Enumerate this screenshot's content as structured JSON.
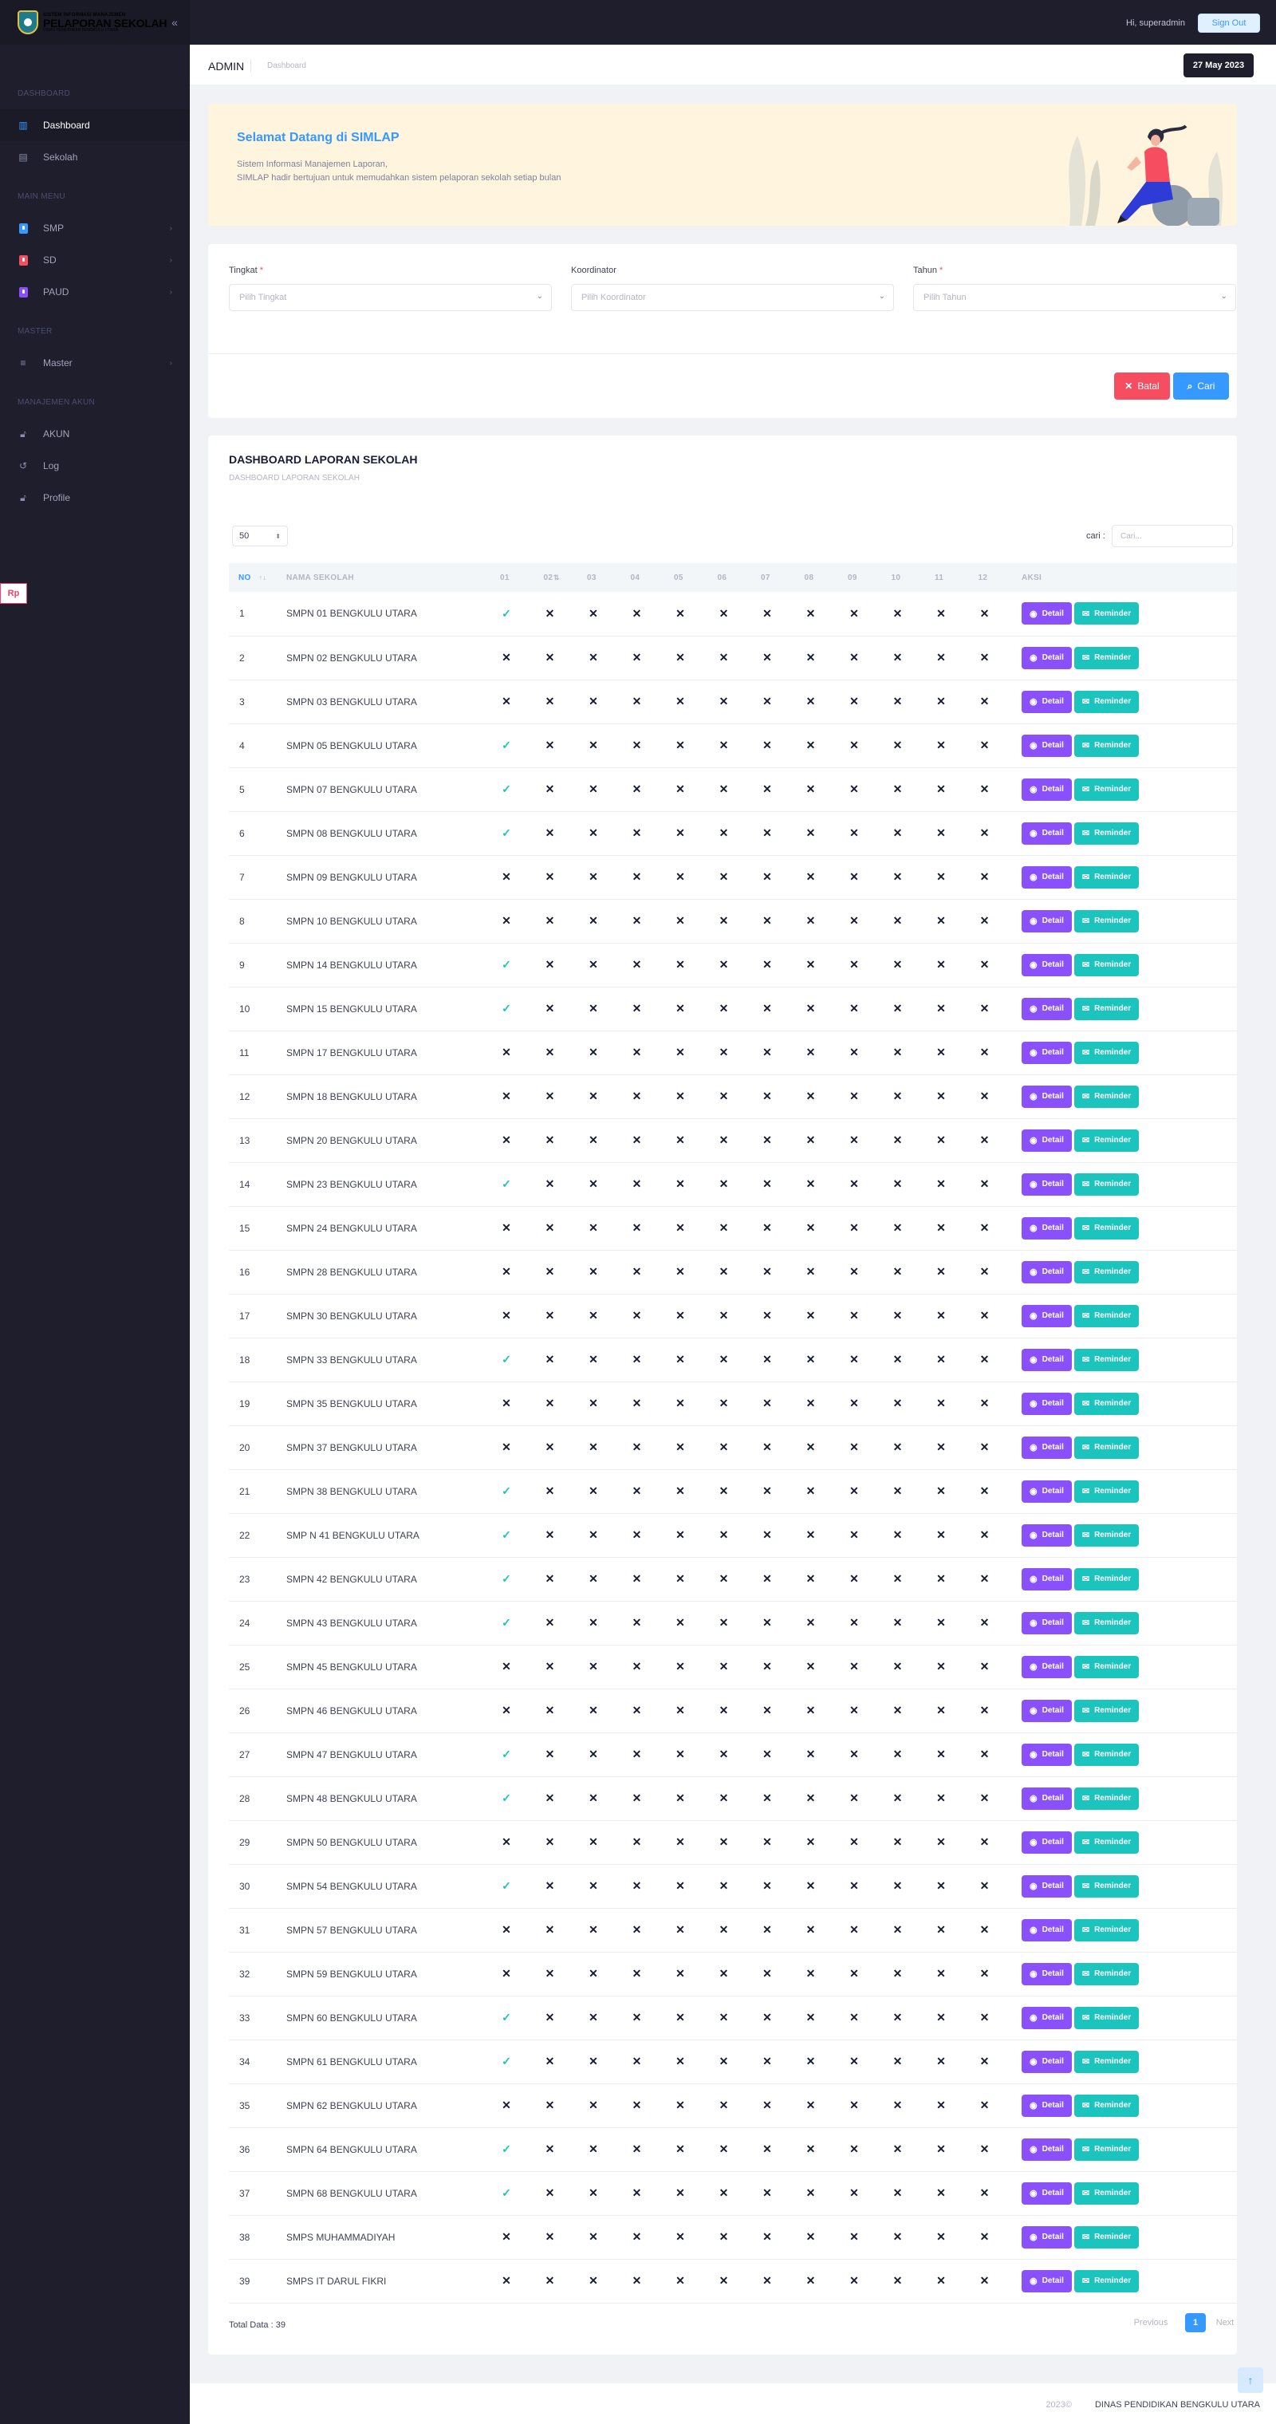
{
  "brand": {
    "line1": "SISTEM INFORMASI MANAJEMEN",
    "line2": "PELAPORAN SEKOLAH",
    "line3": "DINAS PENDIDIKAN BENGKULU UTARA"
  },
  "sidebar": {
    "sections": [
      {
        "label": "DASHBOARD",
        "items": [
          {
            "label": "Dashboard",
            "icon": "chart-icon",
            "active": true
          },
          {
            "label": "Sekolah",
            "icon": "building-icon"
          }
        ]
      },
      {
        "label": "MAIN MENU",
        "items": [
          {
            "label": "SMP",
            "icon": "smp-icon",
            "color": "#3699ff",
            "has_children": true
          },
          {
            "label": "SD",
            "icon": "sd-icon",
            "color": "#f64e60",
            "has_children": true
          },
          {
            "label": "PAUD",
            "icon": "paud-icon",
            "color": "#8950fc",
            "has_children": true
          }
        ]
      },
      {
        "label": "MASTER",
        "items": [
          {
            "label": "Master",
            "icon": "database-icon",
            "has_children": true
          }
        ]
      },
      {
        "label": "MANAJEMEN AKUN",
        "items": [
          {
            "label": "AKUN",
            "icon": "lock-icon"
          },
          {
            "label": "Log",
            "icon": "history-icon"
          },
          {
            "label": "Profile",
            "icon": "lock-icon"
          }
        ]
      }
    ]
  },
  "topbar": {
    "greeting": "Hi, superadmin",
    "signout_label": "Sign Out"
  },
  "subheader": {
    "title": "ADMIN",
    "crumb": "Dashboard",
    "date": "27 May 2023"
  },
  "welcome": {
    "title": "Selamat Datang di SIMLAP",
    "line1": "Sistem Informasi Manajemen Laporan,",
    "line2": "SIMLAP hadir bertujuan untuk memudahkan sistem pelaporan sekolah setiap bulan"
  },
  "filter": {
    "tingkat": {
      "label": "Tingkat",
      "placeholder": "Pilih Tingkat"
    },
    "koordinator": {
      "label": "Koordinator",
      "placeholder": "Pilih Koordinator"
    },
    "tahun": {
      "label": "Tahun",
      "placeholder": "Pilih Tahun"
    },
    "batal_label": "Batal",
    "cari_label": "Cari"
  },
  "table": {
    "title": "DASHBOARD LAPORAN SEKOLAH",
    "subtitle": "DASHBOARD LAPORAN SEKOLAH",
    "page_length": "50",
    "search_label": "cari :",
    "search_placeholder": "Cari...",
    "columns": [
      "NO",
      "NAMA SEKOLAH",
      "01",
      "02",
      "03",
      "04",
      "05",
      "06",
      "07",
      "08",
      "09",
      "10",
      "11",
      "12",
      "AKSI"
    ],
    "detail_label": "Detail",
    "reminder_label": "Reminder",
    "rows": [
      {
        "no": "1",
        "name": "SMPN 01 BENGKULU UTARA",
        "m01": true
      },
      {
        "no": "2",
        "name": "SMPN 02 BENGKULU UTARA",
        "m01": false
      },
      {
        "no": "3",
        "name": "SMPN 03 BENGKULU UTARA",
        "m01": false
      },
      {
        "no": "4",
        "name": "SMPN 05 BENGKULU UTARA",
        "m01": true
      },
      {
        "no": "5",
        "name": "SMPN 07 BENGKULU UTARA",
        "m01": true
      },
      {
        "no": "6",
        "name": "SMPN 08 BENGKULU UTARA",
        "m01": true
      },
      {
        "no": "7",
        "name": "SMPN 09 BENGKULU UTARA",
        "m01": false
      },
      {
        "no": "8",
        "name": "SMPN 10 BENGKULU UTARA",
        "m01": false
      },
      {
        "no": "9",
        "name": "SMPN 14 BENGKULU UTARA",
        "m01": true
      },
      {
        "no": "10",
        "name": "SMPN 15 BENGKULU UTARA",
        "m01": true
      },
      {
        "no": "11",
        "name": "SMPN 17 BENGKULU UTARA",
        "m01": false
      },
      {
        "no": "12",
        "name": "SMPN 18 BENGKULU UTARA",
        "m01": false
      },
      {
        "no": "13",
        "name": "SMPN 20 BENGKULU UTARA",
        "m01": false
      },
      {
        "no": "14",
        "name": "SMPN 23 BENGKULU UTARA",
        "m01": true
      },
      {
        "no": "15",
        "name": "SMPN 24 BENGKULU UTARA",
        "m01": false
      },
      {
        "no": "16",
        "name": "SMPN 28 BENGKULU UTARA",
        "m01": false
      },
      {
        "no": "17",
        "name": "SMPN 30 BENGKULU UTARA",
        "m01": false
      },
      {
        "no": "18",
        "name": "SMPN 33 BENGKULU UTARA",
        "m01": true
      },
      {
        "no": "19",
        "name": "SMPN 35 BENGKULU UTARA",
        "m01": false
      },
      {
        "no": "20",
        "name": "SMPN 37 BENGKULU UTARA",
        "m01": false
      },
      {
        "no": "21",
        "name": "SMPN 38 BENGKULU UTARA",
        "m01": true
      },
      {
        "no": "22",
        "name": "SMP N 41 BENGKULU UTARA",
        "m01": true
      },
      {
        "no": "23",
        "name": "SMPN 42 BENGKULU UTARA",
        "m01": true
      },
      {
        "no": "24",
        "name": "SMPN 43 BENGKULU UTARA",
        "m01": true
      },
      {
        "no": "25",
        "name": "SMPN 45 BENGKULU UTARA",
        "m01": false
      },
      {
        "no": "26",
        "name": "SMPN 46 BENGKULU UTARA",
        "m01": false
      },
      {
        "no": "27",
        "name": "SMPN 47 BENGKULU UTARA",
        "m01": true
      },
      {
        "no": "28",
        "name": "SMPN 48 BENGKULU UTARA",
        "m01": true
      },
      {
        "no": "29",
        "name": "SMPN 50 BENGKULU UTARA",
        "m01": false
      },
      {
        "no": "30",
        "name": "SMPN 54 BENGKULU UTARA",
        "m01": true
      },
      {
        "no": "31",
        "name": "SMPN 57 BENGKULU UTARA",
        "m01": false
      },
      {
        "no": "32",
        "name": "SMPN 59 BENGKULU UTARA",
        "m01": false
      },
      {
        "no": "33",
        "name": "SMPN 60 BENGKULU UTARA",
        "m01": true
      },
      {
        "no": "34",
        "name": "SMPN 61 BENGKULU UTARA",
        "m01": true
      },
      {
        "no": "35",
        "name": "SMPN 62 BENGKULU UTARA",
        "m01": false
      },
      {
        "no": "36",
        "name": "SMPN 64 BENGKULU UTARA",
        "m01": true
      },
      {
        "no": "37",
        "name": "SMPN 68 BENGKULU UTARA",
        "m01": true
      },
      {
        "no": "38",
        "name": "SMPS MUHAMMADIYAH",
        "m01": false
      },
      {
        "no": "39",
        "name": "SMPS IT DARUL FIKRI",
        "m01": false
      }
    ],
    "total_label": "Total Data : 39",
    "pagination": {
      "prev": "Previous",
      "current": "1",
      "next": "Next"
    }
  },
  "footer": {
    "year": "2023©",
    "org": "DINAS PENDIDIKAN BENGKULU UTARA"
  },
  "colors": {
    "primary": "#3699ff",
    "danger": "#f64e60",
    "success": "#1bc5bd",
    "purple": "#8950fc",
    "dark": "#1e1e2d"
  }
}
